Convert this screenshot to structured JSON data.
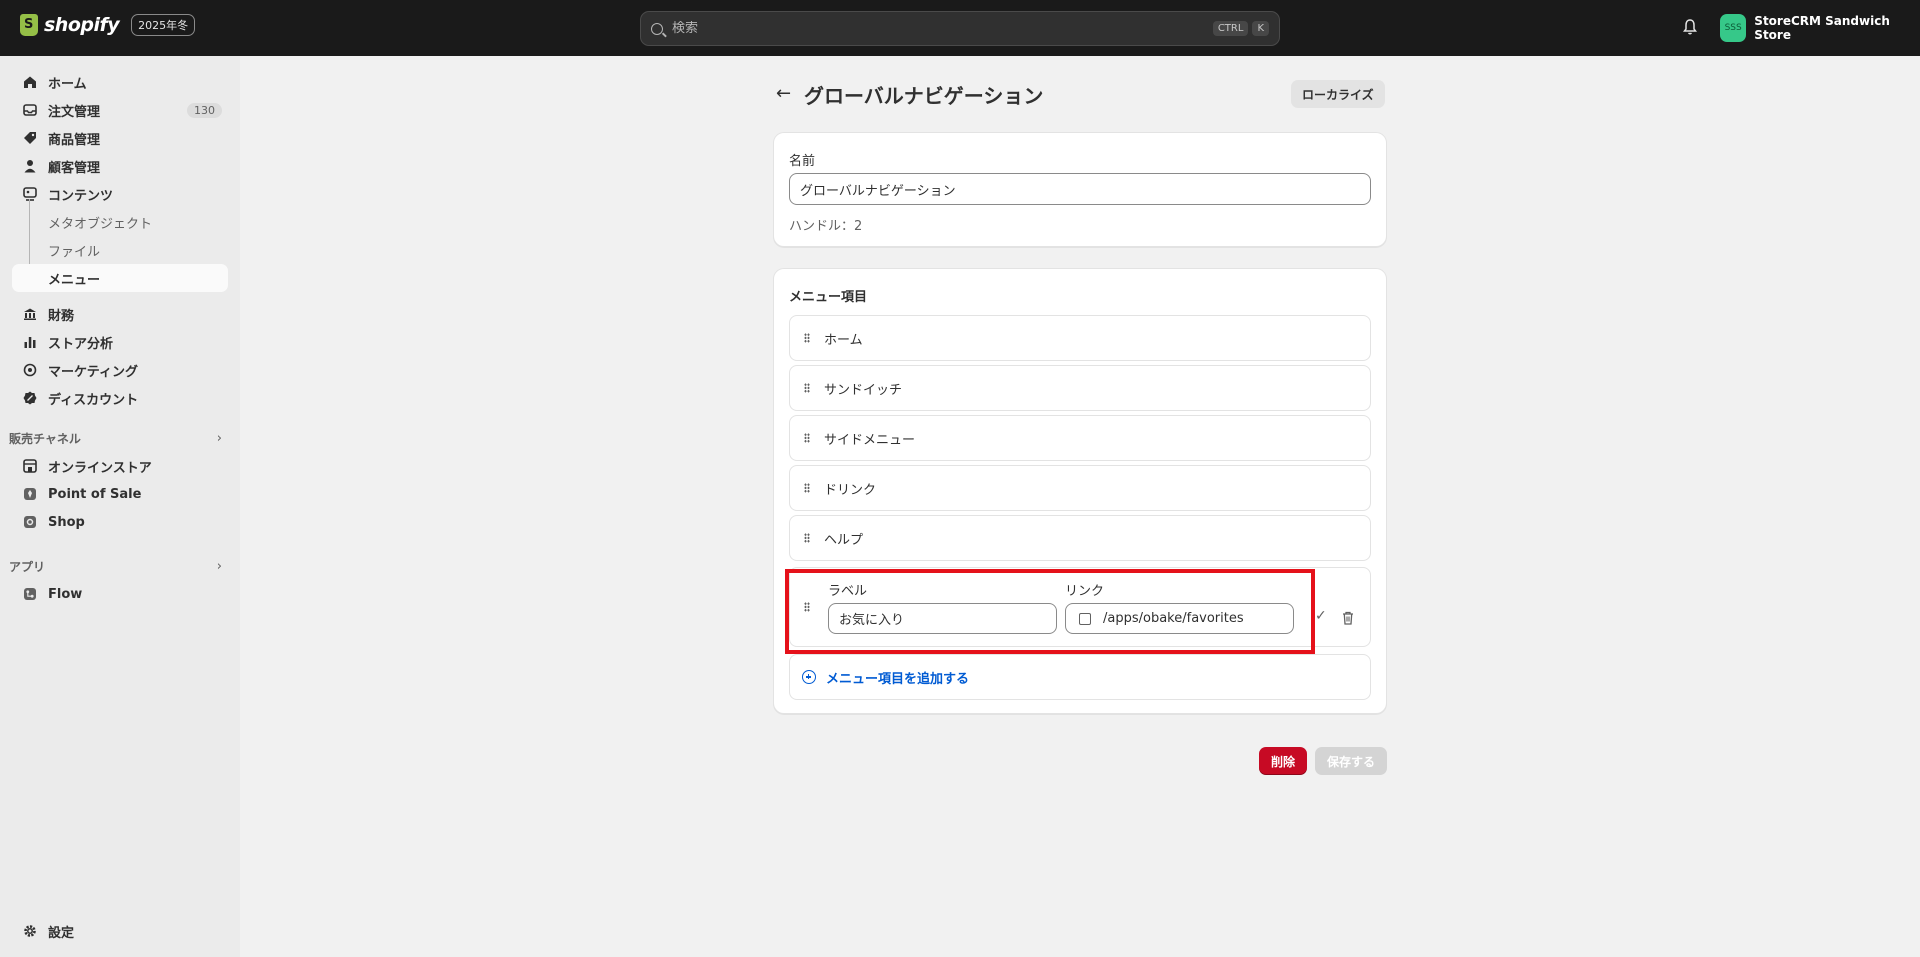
{
  "topbar": {
    "brand": "shopify",
    "edition": "2025年冬",
    "search_placeholder": "検索",
    "shortcut_ctrl": "CTRL",
    "shortcut_k": "K",
    "avatar_initials": "SSS",
    "store_name": "StoreCRM Sandwich Store"
  },
  "sidebar": {
    "home": "ホーム",
    "orders": "注文管理",
    "orders_count": "130",
    "products": "商品管理",
    "customers": "顧客管理",
    "content": "コンテンツ",
    "metaobjects": "メタオブジェクト",
    "files": "ファイル",
    "menus": "メニュー",
    "finance": "財務",
    "analytics": "ストア分析",
    "marketing": "マーケティング",
    "discounts": "ディスカウント",
    "sales_channels_title": "販売チャネル",
    "online_store": "オンラインストア",
    "point_of_sale": "Point of Sale",
    "shop": "Shop",
    "apps_title": "アプリ",
    "flow": "Flow",
    "settings": "設定"
  },
  "page": {
    "title": "グローバルナビゲーション",
    "localize_label": "ローカライズ",
    "name_label": "名前",
    "name_value": "グローバルナビゲーション",
    "handle_text": "ハンドル：2",
    "menu_items_title": "メニュー項目",
    "menu_items": [
      {
        "label": "ホーム"
      },
      {
        "label": "サンドイッチ"
      },
      {
        "label": "サイドメニュー"
      },
      {
        "label": "ドリンク"
      },
      {
        "label": "ヘルプ"
      }
    ],
    "edit_item": {
      "label_heading": "ラベル",
      "label_value": "お気に入り",
      "link_heading": "リンク",
      "link_value": "/apps/obake/favorites"
    },
    "add_item_label": "メニュー項目を追加する",
    "delete_label": "削除",
    "save_label": "保存する"
  },
  "colors": {
    "topbar_bg": "#1a1a1a",
    "accent_link": "#005bd3",
    "delete_red": "#c70a24",
    "highlight_red": "#e5111a",
    "avatar_green": "#36c889"
  }
}
